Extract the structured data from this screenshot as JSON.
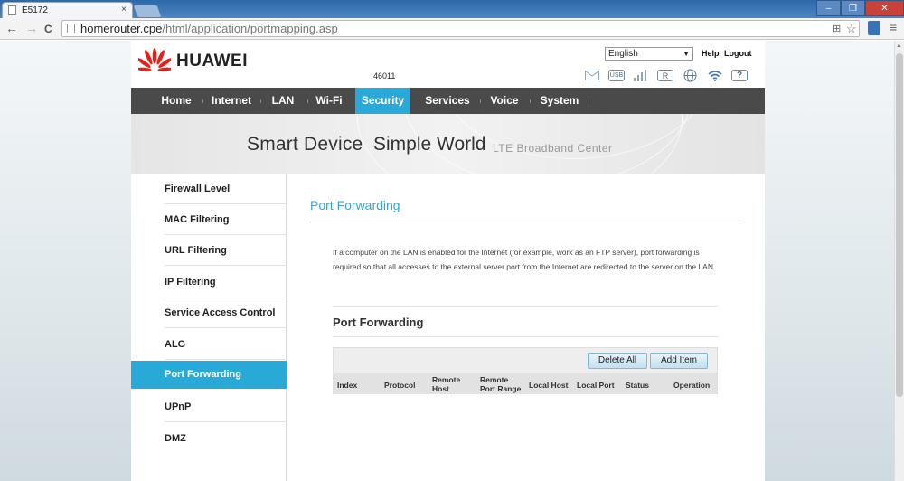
{
  "browser": {
    "tab_title": "E5172",
    "tab_close": "×",
    "url_host": "homerouter.cpe",
    "url_path": "/html/application/portmapping.asp",
    "back": "←",
    "forward": "→",
    "reload": "C"
  },
  "header": {
    "brand": "HUAWEI",
    "operator": "46011",
    "language": "English",
    "help": "Help",
    "logout": "Logout",
    "status_icons": [
      "mail-icon",
      "usb-icon",
      "signal-icon",
      "roaming-icon",
      "globe-icon",
      "wifi-icon",
      "help-icon"
    ]
  },
  "nav": {
    "items": [
      "Home",
      "Internet",
      "LAN",
      "Wi-Fi",
      "Security",
      "Services",
      "Voice",
      "System"
    ],
    "active": "Security"
  },
  "banner": {
    "t1": "Smart Device",
    "t2": "Simple World",
    "t3": "LTE  Broadband  Center"
  },
  "sidebar": {
    "items": [
      "Firewall Level",
      "MAC Filtering",
      "URL Filtering",
      "IP Filtering",
      "Service Access Control",
      "ALG",
      "Port Forwarding",
      "UPnP",
      "DMZ"
    ],
    "active": "Port Forwarding"
  },
  "content": {
    "title": "Port Forwarding",
    "description": "If a computer on the LAN is enabled for the Internet (for example, work as an FTP server), port forwarding is required so that all accesses to the external server port from the Internet are redirected to the server on the LAN.",
    "subtitle": "Port Forwarding",
    "delete_all": "Delete All",
    "add_item": "Add Item",
    "columns": [
      "Index",
      "Protocol",
      "Remote Host",
      "Remote Port Range",
      "Local Host",
      "Local Port",
      "Status",
      "Operation"
    ]
  },
  "colors": {
    "accent": "#29a9d8",
    "nav_bg": "#4a4a4a",
    "logo_red": "#e2231a"
  }
}
